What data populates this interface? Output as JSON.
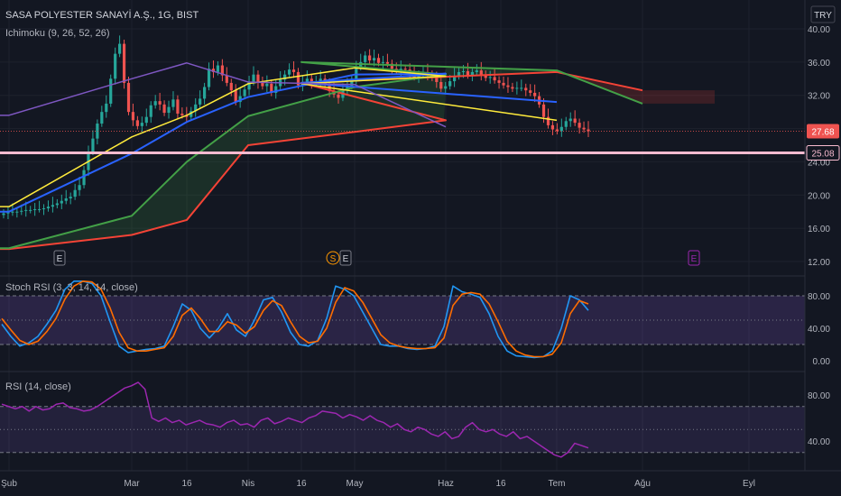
{
  "header": {
    "symbol": "SASA POLYESTER SANAYİ A.Ş., 1G, BIST",
    "currency": "TRY",
    "ichimoku_label": "Ichimoku (9, 26, 52, 26)"
  },
  "markers": {
    "e1": "E",
    "s1": "S",
    "e2": "E",
    "e3": "E"
  },
  "colors": {
    "bg": "#131722",
    "grid": "#1e222d",
    "text": "#b2b5be",
    "up": "#26a69a",
    "down": "#ef5350",
    "tenkan": "#ffeb3b",
    "kijun": "#2962ff",
    "spanA": "#43a047",
    "spanB": "#f44336",
    "chikou": "#7e57c2",
    "stochK": "#2196f3",
    "stochD": "#ff6d00",
    "rsi": "#9c27b0",
    "hline": "#f8bbd0"
  },
  "chart_data": [
    {
      "type": "candlestick",
      "title": "SASA POLYESTER SANAYİ A.Ş., 1G, BIST",
      "ylabel": "TRY",
      "ylim": [
        12,
        40
      ],
      "y_ticks": [
        "40.00",
        "36.00",
        "32.00",
        "28.00",
        "24.00",
        "20.00",
        "16.00",
        "12.00"
      ],
      "x_ticks": [
        "Şub",
        "Mar",
        "16",
        "Nis",
        "16",
        "May",
        "Haz",
        "16",
        "Tem",
        "Ağu",
        "Eyl"
      ],
      "last_price": "27.68",
      "horizontal_line": {
        "value": 25.08,
        "label": "25.08"
      },
      "close_series": [
        17.8,
        17.9,
        18.0,
        18.0,
        18.1,
        18.2,
        18.2,
        18.3,
        18.3,
        18.4,
        18.6,
        18.8,
        19.0,
        19.3,
        19.6,
        19.8,
        20.6,
        21.2,
        23.0,
        25.2,
        26.8,
        28.6,
        30.0,
        31.0,
        34.0,
        37.0,
        38.2,
        33.5,
        30.0,
        29.0,
        28.3,
        28.7,
        29.4,
        30.8,
        31.3,
        30.9,
        29.9,
        30.6,
        31.5,
        29.8,
        29.6,
        29.4,
        30.1,
        30.9,
        31.6,
        33.0,
        35.2,
        34.8,
        35.6,
        34.4,
        33.5,
        32.6,
        31.2,
        31.9,
        32.7,
        33.6,
        34.5,
        33.5,
        33.1,
        33.4,
        32.3,
        33.1,
        33.9,
        34.5,
        35.1,
        34.8,
        33.2,
        33.6,
        34.0,
        33.5,
        33.6,
        34.0,
        33.3,
        32.5,
        32.1,
        31.7,
        32.7,
        33.1,
        34.0,
        35.4,
        36.0,
        36.8,
        36.2,
        36.5,
        35.9,
        36.0,
        35.8,
        35.2,
        35.0,
        35.2,
        35.1,
        34.6,
        34.2,
        34.5,
        34.8,
        34.5,
        34.1,
        33.6,
        32.8,
        33.1,
        33.7,
        34.3,
        34.8,
        34.9,
        34.4,
        34.8,
        35.0,
        34.5,
        34.1,
        34.2,
        33.8,
        33.5,
        33.2,
        33.0,
        32.8,
        32.9,
        32.9,
        32.6,
        32.3,
        31.9,
        30.9,
        29.4,
        28.4,
        27.9,
        27.7,
        28.2,
        28.9,
        29.2,
        28.7,
        28.1,
        27.9,
        27.68
      ],
      "tenkan": [
        {
          "x": "Şub",
          "y": 18.6
        },
        {
          "x": "Mar",
          "y": 27.0
        },
        {
          "x": "16",
          "y": 29.6
        },
        {
          "x": "Nis",
          "y": 33.4
        },
        {
          "x": "May",
          "y": 35.3
        },
        {
          "x": "Haz",
          "y": 34.3
        },
        {
          "x": "16",
          "y": 33.4
        },
        {
          "x": "Tem",
          "y": 29.0
        }
      ],
      "kijun": [
        {
          "x": "Şub",
          "y": 18.0
        },
        {
          "x": "Mar",
          "y": 25.0
        },
        {
          "x": "16",
          "y": 28.8
        },
        {
          "x": "Nis",
          "y": 31.8
        },
        {
          "x": "May",
          "y": 34.5
        },
        {
          "x": "Haz",
          "y": 34.6
        },
        {
          "x": "16",
          "y": 33.5
        },
        {
          "x": "Tem",
          "y": 31.2
        }
      ],
      "senkou_span_a": [
        {
          "x": "Şub",
          "y": 13.6
        },
        {
          "x": "Mar",
          "y": 17.5
        },
        {
          "x": "16",
          "y": 24.0
        },
        {
          "x": "Nis",
          "y": 29.5
        },
        {
          "x": "May",
          "y": 33.0
        },
        {
          "x": "Haz",
          "y": 34.5
        },
        {
          "x": "16",
          "y": 36.0
        },
        {
          "x": "Tem",
          "y": 35.0
        },
        {
          "x": "Ağu",
          "y": 31.0
        }
      ],
      "senkou_span_b": [
        {
          "x": "Şub",
          "y": 13.5
        },
        {
          "x": "Mar",
          "y": 15.2
        },
        {
          "x": "16",
          "y": 17.0
        },
        {
          "x": "Nis",
          "y": 26.0
        },
        {
          "x": "May",
          "y": 27.6
        },
        {
          "x": "Haz",
          "y": 29.0
        },
        {
          "x": "16",
          "y": 33.5
        },
        {
          "x": "Tem",
          "y": 34.8
        },
        {
          "x": "Ağu",
          "y": 32.6
        }
      ],
      "chikou": [
        {
          "x": "Şub",
          "y": 29.6
        },
        {
          "x": "Mar",
          "y": 34.0
        },
        {
          "x": "16",
          "y": 35.9
        },
        {
          "x": "Nis",
          "y": 33.6
        },
        {
          "x": "May",
          "y": 33.3
        },
        {
          "x": "Haz",
          "y": 28.2
        }
      ]
    },
    {
      "type": "line",
      "title": "Stoch RSI (3, 3, 14, 14, close)",
      "ylim": [
        0,
        100
      ],
      "y_ticks": [
        "80.00",
        "40.00",
        "0.00"
      ],
      "band": [
        20,
        80
      ],
      "series": [
        {
          "name": "K",
          "values": [
            45,
            30,
            18,
            22,
            30,
            45,
            62,
            88,
            98,
            98,
            95,
            80,
            48,
            18,
            10,
            12,
            14,
            15,
            18,
            42,
            70,
            62,
            40,
            28,
            40,
            58,
            38,
            30,
            50,
            75,
            78,
            60,
            35,
            20,
            18,
            25,
            52,
            92,
            88,
            80,
            60,
            40,
            20,
            18,
            18,
            15,
            14,
            15,
            18,
            42,
            92,
            85,
            82,
            78,
            58,
            30,
            12,
            6,
            5,
            4,
            5,
            12,
            40,
            80,
            75,
            62
          ]
        },
        {
          "name": "D",
          "values": [
            52,
            38,
            25,
            20,
            24,
            36,
            52,
            76,
            92,
            98,
            97,
            88,
            65,
            35,
            16,
            12,
            12,
            14,
            16,
            30,
            56,
            65,
            52,
            36,
            36,
            48,
            44,
            34,
            42,
            62,
            74,
            68,
            48,
            30,
            22,
            24,
            40,
            72,
            90,
            86,
            72,
            52,
            32,
            22,
            18,
            16,
            15,
            15,
            16,
            28,
            68,
            82,
            84,
            82,
            70,
            48,
            24,
            12,
            7,
            5,
            5,
            8,
            22,
            58,
            74,
            70
          ]
        }
      ]
    },
    {
      "type": "line",
      "title": "RSI (14, close)",
      "y_ticks": [
        "80.00",
        "40.00"
      ],
      "band": [
        30,
        70
      ],
      "series": [
        {
          "name": "RSI",
          "values": [
            72,
            70,
            68,
            70,
            66,
            70,
            67,
            68,
            72,
            73,
            69,
            68,
            66,
            67,
            70,
            74,
            78,
            82,
            86,
            88,
            91,
            85,
            60,
            57,
            60,
            56,
            58,
            54,
            56,
            58,
            55,
            54,
            52,
            56,
            58,
            54,
            55,
            52,
            58,
            60,
            55,
            57,
            60,
            58,
            56,
            60,
            62,
            66,
            65,
            64,
            60,
            63,
            61,
            58,
            62,
            58,
            56,
            52,
            55,
            50,
            48,
            52,
            50,
            46,
            44,
            48,
            42,
            44,
            52,
            56,
            50,
            48,
            50,
            46,
            44,
            48,
            42,
            44,
            40,
            36,
            32,
            28,
            26,
            30,
            38,
            36,
            34
          ]
        }
      ]
    }
  ]
}
